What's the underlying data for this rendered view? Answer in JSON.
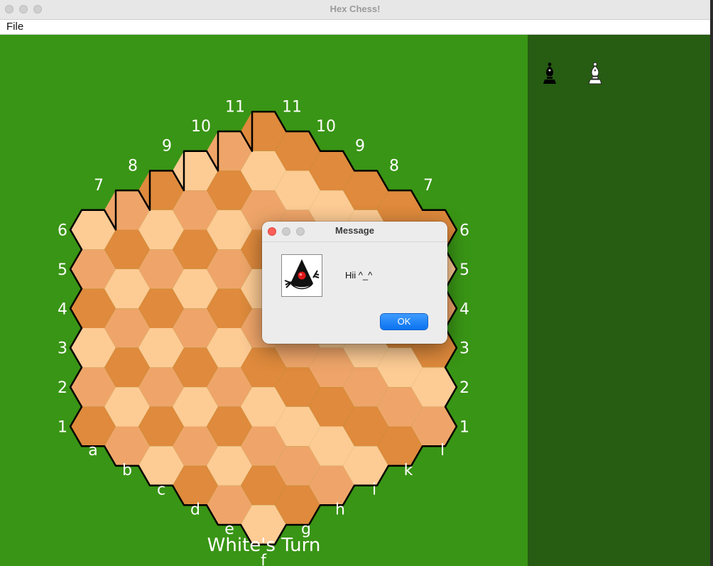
{
  "window": {
    "title": "Hex Chess!"
  },
  "menu": {
    "file": "File"
  },
  "board": {
    "colors": {
      "dark": "#df8a3c",
      "medium": "#efa569",
      "light": "#fdcb94",
      "background": "#399515",
      "outline": "#000000"
    },
    "rank_labels": [
      "1",
      "2",
      "3",
      "4",
      "5",
      "6",
      "7",
      "8",
      "9",
      "10",
      "11"
    ],
    "file_labels": [
      "a",
      "b",
      "c",
      "d",
      "e",
      "f",
      "g",
      "h",
      "i",
      "k",
      "l"
    ]
  },
  "status": "White's Turn",
  "captured": [
    {
      "piece": "black-bishop",
      "color": "#000000"
    },
    {
      "piece": "white-bishop",
      "color": "#ffffff"
    }
  ],
  "dialog": {
    "title": "Message",
    "message": "Hii ^_^",
    "ok_label": "OK",
    "icon": "java-duke-icon"
  }
}
